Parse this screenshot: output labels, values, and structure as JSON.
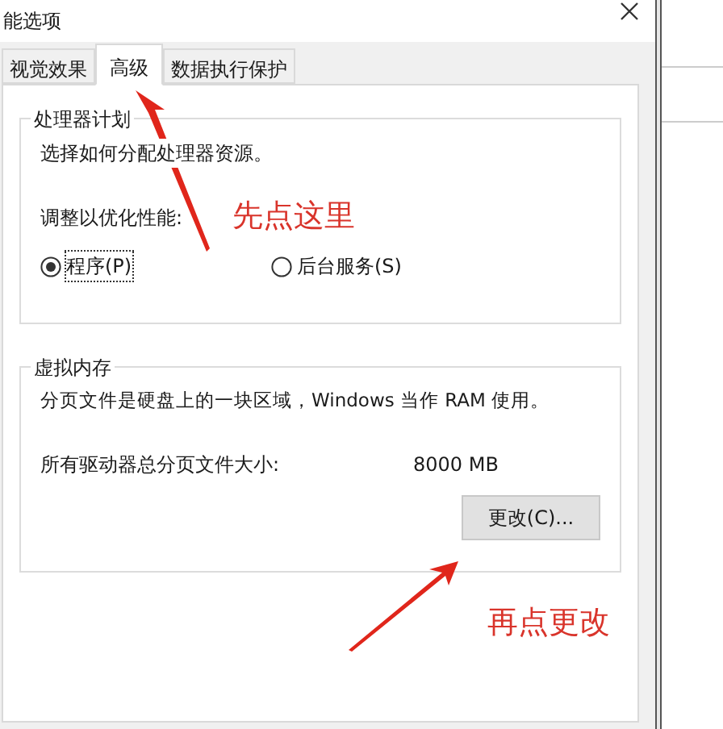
{
  "window": {
    "title": "能选项"
  },
  "tabs": [
    {
      "label": "视觉效果",
      "selected": false
    },
    {
      "label": "高级",
      "selected": true
    },
    {
      "label": "数据执行保护",
      "selected": false
    }
  ],
  "processor_group": {
    "title": "处理器计划",
    "description": "选择如何分配处理器资源。",
    "adjust_label": "调整以优化性能:",
    "options": [
      {
        "label": "程序(P)",
        "selected": true
      },
      {
        "label": "后台服务(S)",
        "selected": false
      }
    ]
  },
  "memory_group": {
    "title": "虚拟内存",
    "description": "分页文件是硬盘上的一块区域，Windows 当作 RAM 使用。",
    "size_label": "所有驱动器总分页文件大小:",
    "size_value": "8000 MB",
    "button": "更改(C)..."
  },
  "annotations": [
    {
      "text": "先点这里"
    },
    {
      "text": "再点更改"
    }
  ]
}
